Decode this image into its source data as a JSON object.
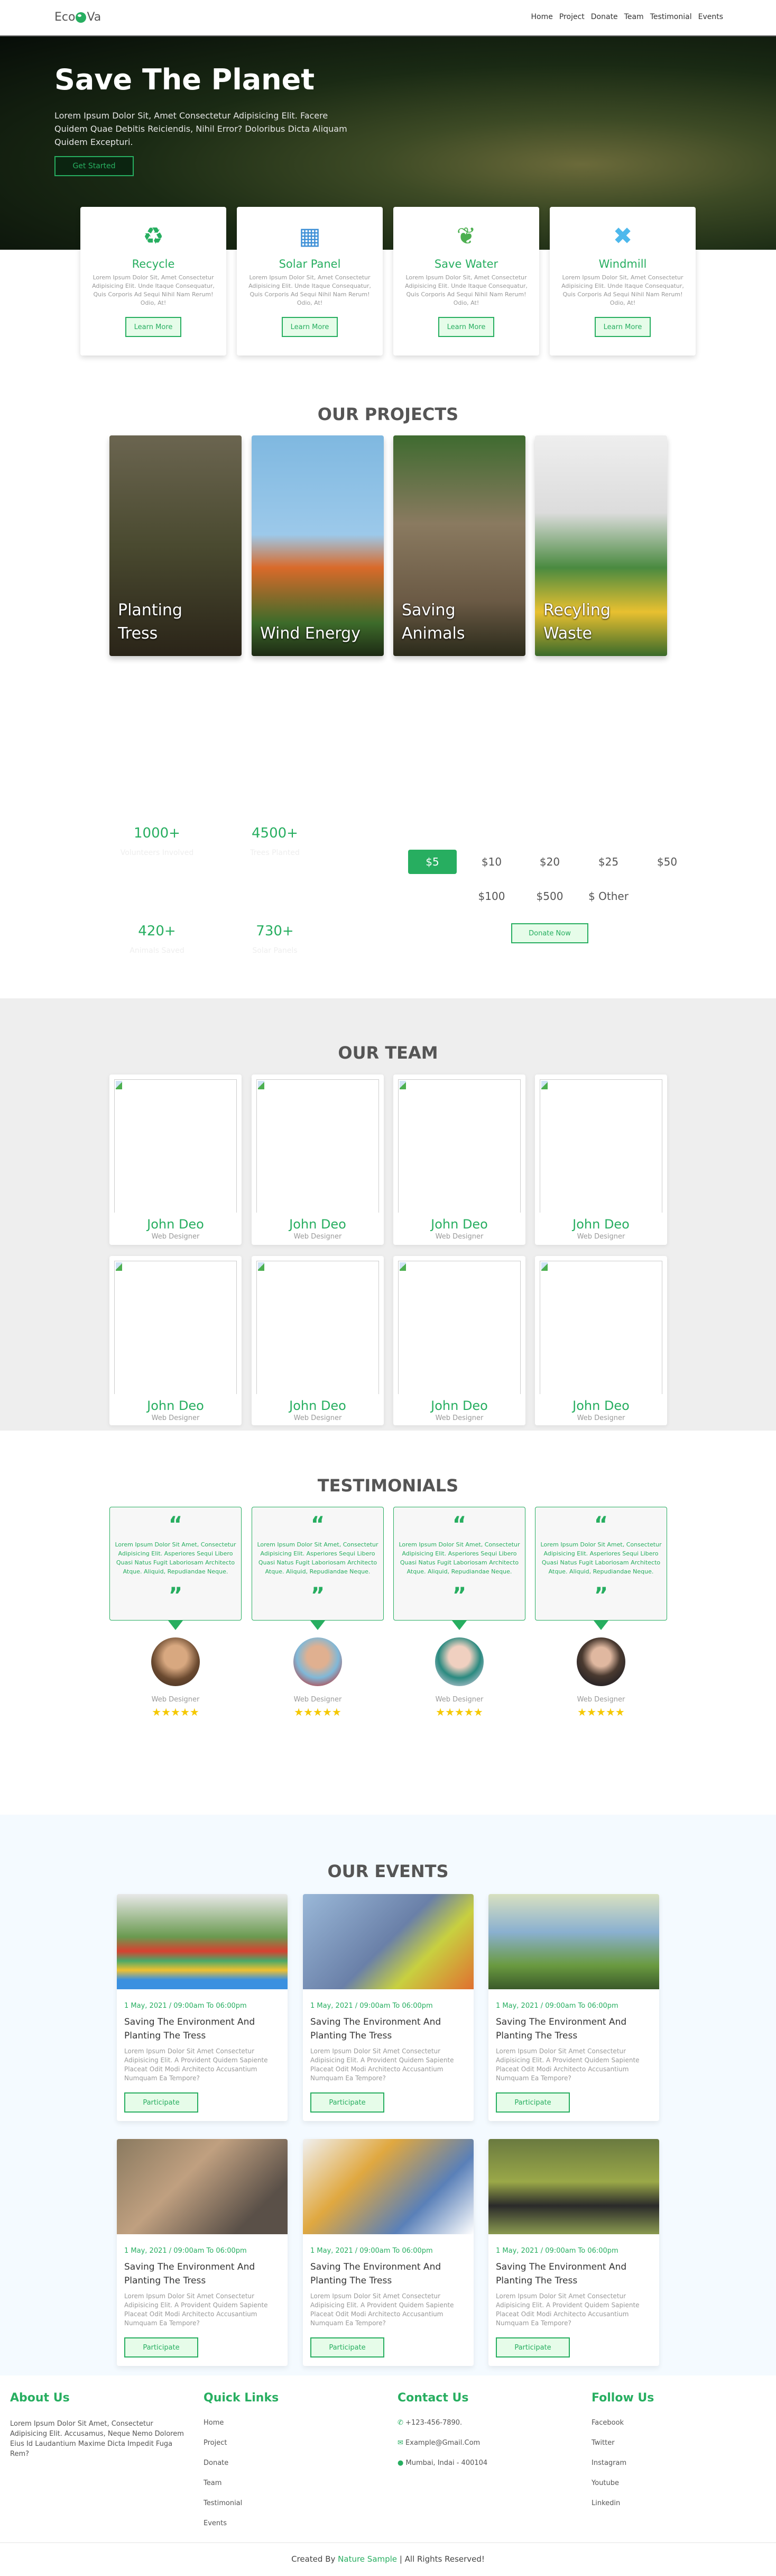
{
  "header": {
    "logo_left": "Eco",
    "logo_right": "Va",
    "nav": [
      "Home",
      "Project",
      "Donate",
      "Team",
      "Testimonial",
      "Events"
    ]
  },
  "hero": {
    "title": "Save The Planet",
    "text": "Lorem Ipsum Dolor Sit, Amet Consectetur Adipisicing Elit. Facere Quidem Quae Debitis Reiciendis, Nihil Error? Doloribus Dicta Aliquam Quidem Excepturi.",
    "button": "Get Started"
  },
  "features": [
    {
      "icon": "recycle-icon",
      "title": "Recycle",
      "text": "Lorem Ipsum Dolor Sit, Amet Consectetur Adipisicing Elit. Unde Itaque Consequatur, Quis Corporis Ad Sequi Nihil Nam Rerum! Odio, At!",
      "button": "Learn More"
    },
    {
      "icon": "solar-panel-icon",
      "title": "Solar Panel",
      "text": "Lorem Ipsum Dolor Sit, Amet Consectetur Adipisicing Elit. Unde Itaque Consequatur, Quis Corporis Ad Sequi Nihil Nam Rerum! Odio, At!",
      "button": "Learn More"
    },
    {
      "icon": "save-water-icon",
      "title": "Save Water",
      "text": "Lorem Ipsum Dolor Sit, Amet Consectetur Adipisicing Elit. Unde Itaque Consequatur, Quis Corporis Ad Sequi Nihil Nam Rerum! Odio, At!",
      "button": "Learn More"
    },
    {
      "icon": "windmill-icon",
      "title": "Windmill",
      "text": "Lorem Ipsum Dolor Sit, Amet Consectetur Adipisicing Elit. Unde Itaque Consequatur, Quis Corporis Ad Sequi Nihil Nam Rerum! Odio, At!",
      "button": "Learn More"
    }
  ],
  "projects": {
    "title": "OUR PROJECTS",
    "items": [
      {
        "label": "Planting Tress"
      },
      {
        "label": "Wind Energy"
      },
      {
        "label": "Saving Animals"
      },
      {
        "label": "Recyling Waste"
      }
    ]
  },
  "stats": [
    {
      "value": "1000+",
      "label": "Volunteers Involved"
    },
    {
      "value": "4500+",
      "label": "Trees Planted"
    },
    {
      "value": "420+",
      "label": "Animals Saved"
    },
    {
      "value": "730+",
      "label": "Solar Panels"
    }
  ],
  "donate": {
    "amounts": [
      "$5",
      "$10",
      "$20",
      "$25",
      "$50",
      "$100",
      "$500",
      "$ Other"
    ],
    "selected": "$5",
    "button": "Donate Now"
  },
  "team": {
    "title": "OUR TEAM",
    "members": [
      {
        "name": "John Deo",
        "role": "Web Designer"
      },
      {
        "name": "John Deo",
        "role": "Web Designer"
      },
      {
        "name": "John Deo",
        "role": "Web Designer"
      },
      {
        "name": "John Deo",
        "role": "Web Designer"
      },
      {
        "name": "John Deo",
        "role": "Web Designer"
      },
      {
        "name": "John Deo",
        "role": "Web Designer"
      },
      {
        "name": "John Deo",
        "role": "Web Designer"
      },
      {
        "name": "John Deo",
        "role": "Web Designer"
      }
    ]
  },
  "testimonials": {
    "title": "TESTIMONIALS",
    "items": [
      {
        "text": "Lorem Ipsum Dolor Sit Amet, Consectetur Adipisicing Elit. Asperiores Sequi Libero Quasi Natus Fugit Laboriosam Architecto Atque. Aliquid, Repudiandae Neque.",
        "role": "Web Designer",
        "rating": 5
      },
      {
        "text": "Lorem Ipsum Dolor Sit Amet, Consectetur Adipisicing Elit. Asperiores Sequi Libero Quasi Natus Fugit Laboriosam Architecto Atque. Aliquid, Repudiandae Neque.",
        "role": "Web Designer",
        "rating": 5
      },
      {
        "text": "Lorem Ipsum Dolor Sit Amet, Consectetur Adipisicing Elit. Asperiores Sequi Libero Quasi Natus Fugit Laboriosam Architecto Atque. Aliquid, Repudiandae Neque.",
        "role": "Web Designer",
        "rating": 5
      },
      {
        "text": "Lorem Ipsum Dolor Sit Amet, Consectetur Adipisicing Elit. Asperiores Sequi Libero Quasi Natus Fugit Laboriosam Architecto Atque. Aliquid, Repudiandae Neque.",
        "role": "Web Designer",
        "rating": 5
      }
    ]
  },
  "events": {
    "title": "OUR EVENTS",
    "items": [
      {
        "date": "1 May, 2021 / 09:00am To 06:00pm",
        "title": "Saving The Environment And Planting The Tress",
        "text": "Lorem Ipsum Dolor Sit Amet Consectetur Adipisicing Elit. A Provident Quidem Sapiente Placeat Odit Modi Architecto Accusantium Numquam Ea Tempore?",
        "button": "Participate"
      },
      {
        "date": "1 May, 2021 / 09:00am To 06:00pm",
        "title": "Saving The Environment And Planting The Tress",
        "text": "Lorem Ipsum Dolor Sit Amet Consectetur Adipisicing Elit. A Provident Quidem Sapiente Placeat Odit Modi Architecto Accusantium Numquam Ea Tempore?",
        "button": "Participate"
      },
      {
        "date": "1 May, 2021 / 09:00am To 06:00pm",
        "title": "Saving The Environment And Planting The Tress",
        "text": "Lorem Ipsum Dolor Sit Amet Consectetur Adipisicing Elit. A Provident Quidem Sapiente Placeat Odit Modi Architecto Accusantium Numquam Ea Tempore?",
        "button": "Participate"
      },
      {
        "date": "1 May, 2021 / 09:00am To 06:00pm",
        "title": "Saving The Environment And Planting The Tress",
        "text": "Lorem Ipsum Dolor Sit Amet Consectetur Adipisicing Elit. A Provident Quidem Sapiente Placeat Odit Modi Architecto Accusantium Numquam Ea Tempore?",
        "button": "Participate"
      },
      {
        "date": "1 May, 2021 / 09:00am To 06:00pm",
        "title": "Saving The Environment And Planting The Tress",
        "text": "Lorem Ipsum Dolor Sit Amet Consectetur Adipisicing Elit. A Provident Quidem Sapiente Placeat Odit Modi Architecto Accusantium Numquam Ea Tempore?",
        "button": "Participate"
      },
      {
        "date": "1 May, 2021 / 09:00am To 06:00pm",
        "title": "Saving The Environment And Planting The Tress",
        "text": "Lorem Ipsum Dolor Sit Amet Consectetur Adipisicing Elit. A Provident Quidem Sapiente Placeat Odit Modi Architecto Accusantium Numquam Ea Tempore?",
        "button": "Participate"
      }
    ]
  },
  "footer": {
    "about": {
      "title": "About Us",
      "text": "Lorem Ipsum Dolor Sit Amet, Consectetur Adipisicing Elit. Accusamus, Neque Nemo Dolorem Eius Id Laudantium Maxime Dicta Impedit Fuga Rem?"
    },
    "quick_links": {
      "title": "Quick Links",
      "items": [
        "Home",
        "Project",
        "Donate",
        "Team",
        "Testimonial",
        "Events"
      ]
    },
    "contact": {
      "title": "Contact Us",
      "phone": "+123-456-7890.",
      "email": "Example@Gmail.Com",
      "address": "Mumbai, Indai - 400104"
    },
    "follow": {
      "title": "Follow Us",
      "items": [
        "Facebook",
        "Twitter",
        "Instagram",
        "Youtube",
        "Linkedin"
      ]
    },
    "copyright": {
      "prefix": "Created By",
      "brand": "Nature Sample",
      "suffix": "| All Rights Reserved!"
    }
  },
  "colors": {
    "accent": "#27ae60",
    "button_bg": "#e6fce9",
    "star": "#f5c800"
  }
}
